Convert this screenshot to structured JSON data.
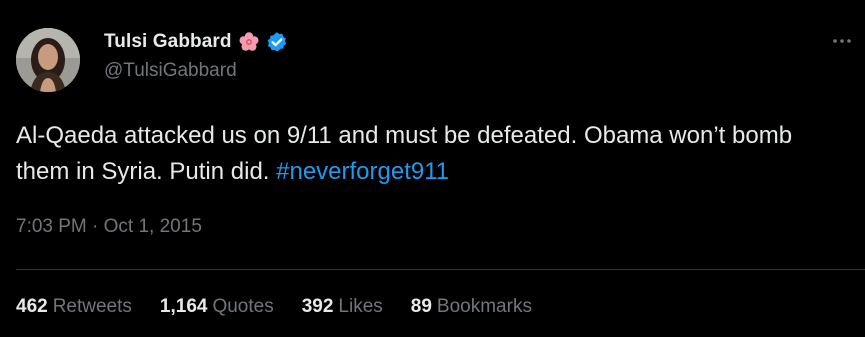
{
  "author": {
    "display_name": "Tulsi Gabbard",
    "handle": "@TulsiGabbard",
    "emoji_icon": "hibiscus-flower-icon",
    "verified_icon": "verified-badge-icon"
  },
  "tweet": {
    "text_before_hashtag": "Al-Qaeda attacked us on 9/11 and must be defeated. Obama won’t bomb them in Syria. Putin did.",
    "hashtag": "#neverforget911"
  },
  "meta": {
    "time": "7:03 PM",
    "separator": " · ",
    "date": "Oct 1, 2015"
  },
  "stats": [
    {
      "count": "462",
      "label": "Retweets"
    },
    {
      "count": "1,164",
      "label": "Quotes"
    },
    {
      "count": "392",
      "label": "Likes"
    },
    {
      "count": "89",
      "label": "Bookmarks"
    }
  ],
  "colors": {
    "background": "#000000",
    "primary_text": "#e7e9ea",
    "secondary_text": "#71767b",
    "link": "#1d9bf0",
    "verified": "#1d9bf0",
    "divider": "#2f3336"
  },
  "icons": {
    "more": "more-options-icon"
  }
}
